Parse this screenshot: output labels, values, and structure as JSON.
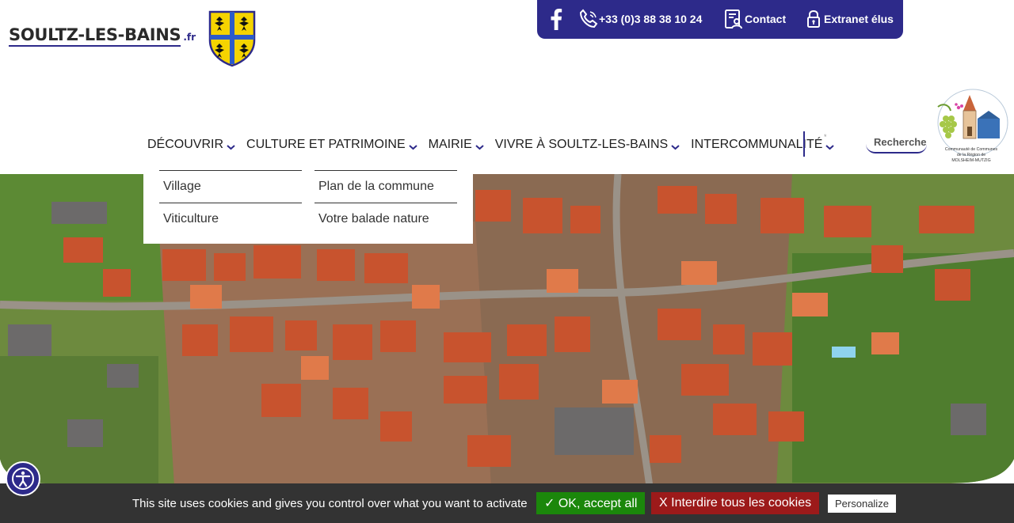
{
  "logo": {
    "name": "SOULTZ-LES-BAINS",
    "tld": ".fr"
  },
  "topbar": {
    "phone": "+33 (0)3 88 38 10 24",
    "contact": "Contact",
    "extranet": "Extranet élus"
  },
  "nav": {
    "items": [
      {
        "label": "DÉCOUVRIR"
      },
      {
        "label": "CULTURE ET PATRIMOINE"
      },
      {
        "label": "MAIRIE"
      },
      {
        "label": "VIVRE À SOULTZ-LES-BAINS"
      },
      {
        "label": "INTERCOMMUNALITÉ"
      }
    ],
    "search_placeholder": "Recherche"
  },
  "dropdown": {
    "col1": [
      "Village",
      "Viticulture"
    ],
    "col2": [
      "Plan de la commune",
      "Votre balade nature"
    ]
  },
  "partner_logo": {
    "line1": "Communauté de Communes",
    "line2": "de la Région de",
    "line3": "MOLSHEIM-MUTZIG"
  },
  "cookie": {
    "text": "This site uses cookies and gives you control over what you want to activate",
    "accept": "✓ OK, accept all",
    "deny": "X Interdire tous les cookies",
    "personalize": "Personalize"
  },
  "colors": {
    "brand": "#2d2a8a",
    "cookie_bg": "#333333",
    "accept": "#1b870b",
    "deny": "#9c1a1a"
  }
}
